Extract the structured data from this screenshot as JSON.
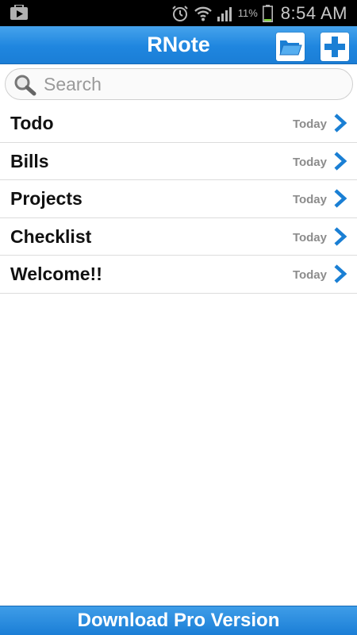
{
  "status_bar": {
    "icons": [
      "play-store-icon",
      "alarm-icon",
      "wifi-icon",
      "signal-icon",
      "battery-icon"
    ],
    "battery_percent": "11%",
    "time": "8:54 AM"
  },
  "header": {
    "title": "RNote",
    "folder_icon": "folder-icon",
    "add_icon": "plus-icon",
    "accent_color": "#1f86df"
  },
  "search": {
    "placeholder": "Search",
    "value": "",
    "icon": "search-icon"
  },
  "notes": [
    {
      "title": "Todo",
      "date": "Today"
    },
    {
      "title": "Bills",
      "date": "Today"
    },
    {
      "title": "Projects",
      "date": "Today"
    },
    {
      "title": "Checklist",
      "date": "Today"
    },
    {
      "title": "Welcome!!",
      "date": "Today"
    }
  ],
  "banner": {
    "label": "Download Pro Version"
  }
}
